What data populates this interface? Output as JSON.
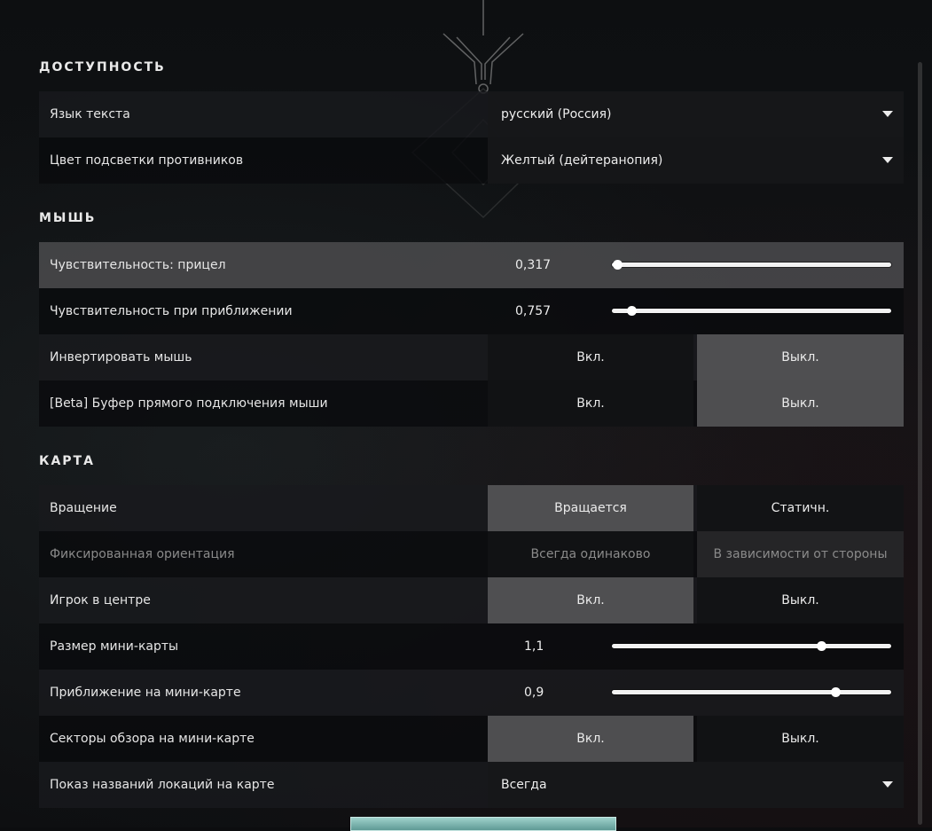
{
  "sections": {
    "accessibility": {
      "title": "ДОСТУПНОСТЬ",
      "text_language": {
        "label": "Язык текста",
        "value": "русский (Россия)"
      },
      "enemy_highlight": {
        "label": "Цвет подсветки противников",
        "value": "Желтый (дейтеранопия)"
      }
    },
    "mouse": {
      "title": "МЫШЬ",
      "sensitivity_aim": {
        "label": "Чувствительность: прицел",
        "value": "0,317",
        "slider_fraction": 0.02
      },
      "sensitivity_zoom": {
        "label": "Чувствительность при приближении",
        "value": "0,757",
        "slider_fraction": 0.07
      },
      "invert_mouse": {
        "label": "Инвертировать мышь",
        "on": "Вкл.",
        "off": "Выкл.",
        "selected": "off"
      },
      "raw_input": {
        "label": "[Beta] Буфер прямого подключения мыши",
        "on": "Вкл.",
        "off": "Выкл.",
        "selected": "off"
      }
    },
    "map": {
      "title": "КАРТА",
      "rotation": {
        "label": "Вращение",
        "opt1": "Вращается",
        "opt2": "Статичн.",
        "selected": "opt1"
      },
      "fixed_orientation": {
        "label": "Фиксированная ориентация",
        "opt1": "Всегда одинаково",
        "opt2": "В зависимости от стороны",
        "disabled": true
      },
      "player_centered": {
        "label": "Игрок в центре",
        "on": "Вкл.",
        "off": "Выкл.",
        "selected": "on"
      },
      "minimap_size": {
        "label": "Размер мини-карты",
        "value": "1,1",
        "slider_fraction": 0.75
      },
      "minimap_zoom": {
        "label": "Приближение на мини-карте",
        "value": "0,9",
        "slider_fraction": 0.8
      },
      "vision_cones": {
        "label": "Секторы обзора на мини-карте",
        "on": "Вкл.",
        "off": "Выкл.",
        "selected": "on"
      },
      "location_names": {
        "label": "Показ названий локаций на карте",
        "value": "Всегда"
      }
    }
  },
  "colors": {
    "selected_segment": "#525254",
    "highlight_row": "#464648",
    "bottom_tab": "#7fb7b1"
  }
}
